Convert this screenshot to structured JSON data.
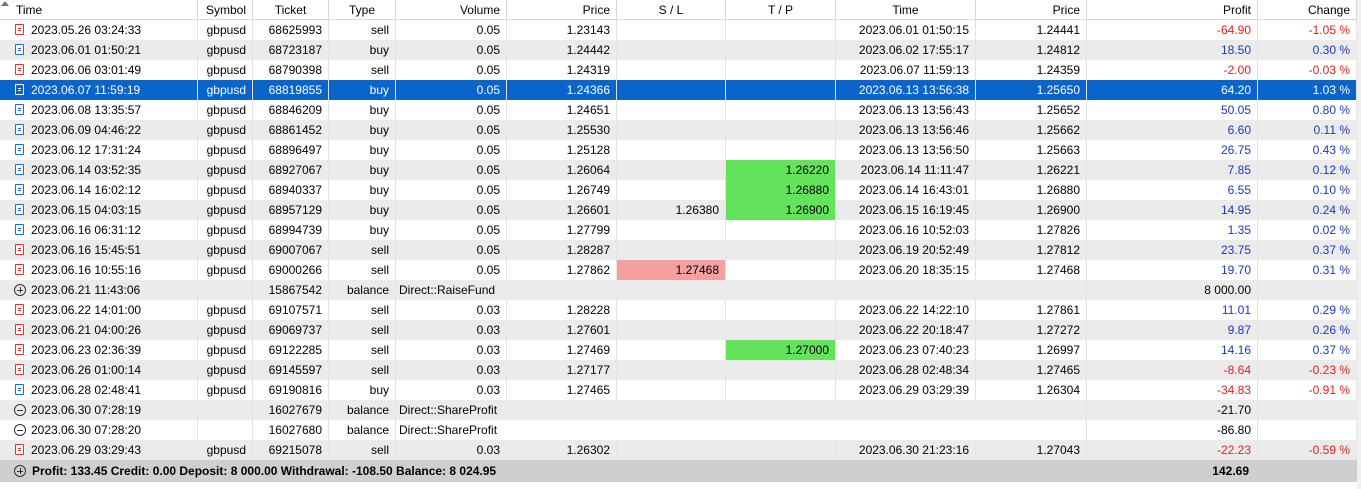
{
  "columns": [
    "Time",
    "Symbol",
    "Ticket",
    "Type",
    "Volume",
    "Price",
    "S / L",
    "T / P",
    "Time",
    "Price",
    "Profit",
    "Change"
  ],
  "colors": {
    "selected_bg": "#0a64c9",
    "alt_row": "#ebebeb",
    "tp_fill": "#63e35b",
    "sl_fill": "#f4a0a0",
    "negative": "#e02020",
    "positive": "#1a39b8"
  },
  "rows": [
    {
      "kind": "trade",
      "dir": "sell",
      "time": "2023.05.26 03:24:33",
      "symbol": "gbpusd",
      "ticket": "68625993",
      "type": "sell",
      "volume": "0.05",
      "price": "1.23143",
      "sl": "",
      "tp": "",
      "close_time": "2023.06.01 01:50:15",
      "close_price": "1.24441",
      "profit": "-64.90",
      "change": "-1.05 %",
      "profit_sign": "neg"
    },
    {
      "kind": "trade",
      "dir": "buy",
      "time": "2023.06.01 01:50:21",
      "symbol": "gbpusd",
      "ticket": "68723187",
      "type": "buy",
      "volume": "0.05",
      "price": "1.24442",
      "sl": "",
      "tp": "",
      "close_time": "2023.06.02 17:55:17",
      "close_price": "1.24812",
      "profit": "18.50",
      "change": "0.30 %",
      "profit_sign": "pos"
    },
    {
      "kind": "trade",
      "dir": "sell",
      "time": "2023.06.06 03:01:49",
      "symbol": "gbpusd",
      "ticket": "68790398",
      "type": "sell",
      "volume": "0.05",
      "price": "1.24319",
      "sl": "",
      "tp": "",
      "close_time": "2023.06.07 11:59:13",
      "close_price": "1.24359",
      "profit": "-2.00",
      "change": "-0.03 %",
      "profit_sign": "neg"
    },
    {
      "kind": "trade",
      "dir": "buy",
      "selected": true,
      "time": "2023.06.07 11:59:19",
      "symbol": "gbpusd",
      "ticket": "68819855",
      "type": "buy",
      "volume": "0.05",
      "price": "1.24366",
      "sl": "",
      "tp": "",
      "close_time": "2023.06.13 13:56:38",
      "close_price": "1.25650",
      "profit": "64.20",
      "change": "1.03 %",
      "profit_sign": "pos"
    },
    {
      "kind": "trade",
      "dir": "buy",
      "time": "2023.06.08 13:35:57",
      "symbol": "gbpusd",
      "ticket": "68846209",
      "type": "buy",
      "volume": "0.05",
      "price": "1.24651",
      "sl": "",
      "tp": "",
      "close_time": "2023.06.13 13:56:43",
      "close_price": "1.25652",
      "profit": "50.05",
      "change": "0.80 %",
      "profit_sign": "pos"
    },
    {
      "kind": "trade",
      "dir": "buy",
      "time": "2023.06.09 04:46:22",
      "symbol": "gbpusd",
      "ticket": "68861452",
      "type": "buy",
      "volume": "0.05",
      "price": "1.25530",
      "sl": "",
      "tp": "",
      "close_time": "2023.06.13 13:56:46",
      "close_price": "1.25662",
      "profit": "6.60",
      "change": "0.11 %",
      "profit_sign": "pos"
    },
    {
      "kind": "trade",
      "dir": "buy",
      "time": "2023.06.12 17:31:24",
      "symbol": "gbpusd",
      "ticket": "68896497",
      "type": "buy",
      "volume": "0.05",
      "price": "1.25128",
      "sl": "",
      "tp": "",
      "close_time": "2023.06.13 13:56:50",
      "close_price": "1.25663",
      "profit": "26.75",
      "change": "0.43 %",
      "profit_sign": "pos"
    },
    {
      "kind": "trade",
      "dir": "buy",
      "time": "2023.06.14 03:52:35",
      "symbol": "gbpusd",
      "ticket": "68927067",
      "type": "buy",
      "volume": "0.05",
      "price": "1.26064",
      "sl": "",
      "tp": "1.26220",
      "close_time": "2023.06.14 11:11:47",
      "close_price": "1.26221",
      "profit": "7.85",
      "change": "0.12 %",
      "profit_sign": "pos"
    },
    {
      "kind": "trade",
      "dir": "buy",
      "time": "2023.06.14 16:02:12",
      "symbol": "gbpusd",
      "ticket": "68940337",
      "type": "buy",
      "volume": "0.05",
      "price": "1.26749",
      "sl": "",
      "tp": "1.26880",
      "close_time": "2023.06.14 16:43:01",
      "close_price": "1.26880",
      "profit": "6.55",
      "change": "0.10 %",
      "profit_sign": "pos"
    },
    {
      "kind": "trade",
      "dir": "buy",
      "time": "2023.06.15 04:03:15",
      "symbol": "gbpusd",
      "ticket": "68957129",
      "type": "buy",
      "volume": "0.05",
      "price": "1.26601",
      "sl": "1.26380",
      "tp": "1.26900",
      "close_time": "2023.06.15 16:19:45",
      "close_price": "1.26900",
      "profit": "14.95",
      "change": "0.24 %",
      "profit_sign": "pos"
    },
    {
      "kind": "trade",
      "dir": "buy",
      "time": "2023.06.16 06:31:12",
      "symbol": "gbpusd",
      "ticket": "68994739",
      "type": "buy",
      "volume": "0.05",
      "price": "1.27799",
      "sl": "",
      "tp": "",
      "close_time": "2023.06.16 10:52:03",
      "close_price": "1.27826",
      "profit": "1.35",
      "change": "0.02 %",
      "profit_sign": "pos"
    },
    {
      "kind": "trade",
      "dir": "sell",
      "time": "2023.06.16 15:45:51",
      "symbol": "gbpusd",
      "ticket": "69007067",
      "type": "sell",
      "volume": "0.05",
      "price": "1.28287",
      "sl": "",
      "tp": "",
      "close_time": "2023.06.19 20:52:49",
      "close_price": "1.27812",
      "profit": "23.75",
      "change": "0.37 %",
      "profit_sign": "pos"
    },
    {
      "kind": "trade",
      "dir": "sell",
      "time": "2023.06.16 10:55:16",
      "symbol": "gbpusd",
      "ticket": "69000266",
      "type": "sell",
      "volume": "0.05",
      "price": "1.27862",
      "sl": "1.27468",
      "sl_hit": true,
      "tp": "",
      "close_time": "2023.06.20 18:35:15",
      "close_price": "1.27468",
      "profit": "19.70",
      "change": "0.31 %",
      "profit_sign": "pos"
    },
    {
      "kind": "balance",
      "icon": "plus",
      "time": "2023.06.21 11:43:06",
      "ticket": "15867542",
      "type": "balance",
      "comment": "Direct::RaiseFund",
      "profit": "8 000.00"
    },
    {
      "kind": "trade",
      "dir": "sell",
      "time": "2023.06.22 14:01:00",
      "symbol": "gbpusd",
      "ticket": "69107571",
      "type": "sell",
      "volume": "0.03",
      "price": "1.28228",
      "sl": "",
      "tp": "",
      "close_time": "2023.06.22 14:22:10",
      "close_price": "1.27861",
      "profit": "11.01",
      "change": "0.29 %",
      "profit_sign": "pos"
    },
    {
      "kind": "trade",
      "dir": "sell",
      "time": "2023.06.21 04:00:26",
      "symbol": "gbpusd",
      "ticket": "69069737",
      "type": "sell",
      "volume": "0.03",
      "price": "1.27601",
      "sl": "",
      "tp": "",
      "close_time": "2023.06.22 20:18:47",
      "close_price": "1.27272",
      "profit": "9.87",
      "change": "0.26 %",
      "profit_sign": "pos"
    },
    {
      "kind": "trade",
      "dir": "sell",
      "time": "2023.06.23 02:36:39",
      "symbol": "gbpusd",
      "ticket": "69122285",
      "type": "sell",
      "volume": "0.03",
      "price": "1.27469",
      "sl": "",
      "tp": "1.27000",
      "close_time": "2023.06.23 07:40:23",
      "close_price": "1.26997",
      "profit": "14.16",
      "change": "0.37 %",
      "profit_sign": "pos"
    },
    {
      "kind": "trade",
      "dir": "sell",
      "time": "2023.06.26 01:00:14",
      "symbol": "gbpusd",
      "ticket": "69145597",
      "type": "sell",
      "volume": "0.03",
      "price": "1.27177",
      "sl": "",
      "tp": "",
      "close_time": "2023.06.28 02:48:34",
      "close_price": "1.27465",
      "profit": "-8.64",
      "change": "-0.23 %",
      "profit_sign": "neg"
    },
    {
      "kind": "trade",
      "dir": "buy",
      "time": "2023.06.28 02:48:41",
      "symbol": "gbpusd",
      "ticket": "69190816",
      "type": "buy",
      "volume": "0.03",
      "price": "1.27465",
      "sl": "",
      "tp": "",
      "close_time": "2023.06.29 03:29:39",
      "close_price": "1.26304",
      "profit": "-34.83",
      "change": "-0.91 %",
      "profit_sign": "neg"
    },
    {
      "kind": "balance",
      "icon": "minus",
      "time": "2023.06.30 07:28:19",
      "ticket": "16027679",
      "type": "balance",
      "comment": "Direct::ShareProfit",
      "profit": "-21.70"
    },
    {
      "kind": "balance",
      "icon": "minus",
      "time": "2023.06.30 07:28:20",
      "ticket": "16027680",
      "type": "balance",
      "comment": "Direct::ShareProfit",
      "profit": "-86.80"
    },
    {
      "kind": "trade",
      "dir": "sell",
      "time": "2023.06.29 03:29:43",
      "symbol": "gbpusd",
      "ticket": "69215078",
      "type": "sell",
      "volume": "0.03",
      "price": "1.26302",
      "sl": "",
      "tp": "",
      "close_time": "2023.06.30 21:23:16",
      "close_price": "1.27043",
      "profit": "-22.23",
      "change": "-0.59 %",
      "profit_sign": "neg"
    }
  ],
  "footer": {
    "summary": "Profit: 133.45  Credit: 0.00  Deposit: 8 000.00  Withdrawal: -108.50  Balance: 8 024.95",
    "total_profit": "142.69"
  }
}
